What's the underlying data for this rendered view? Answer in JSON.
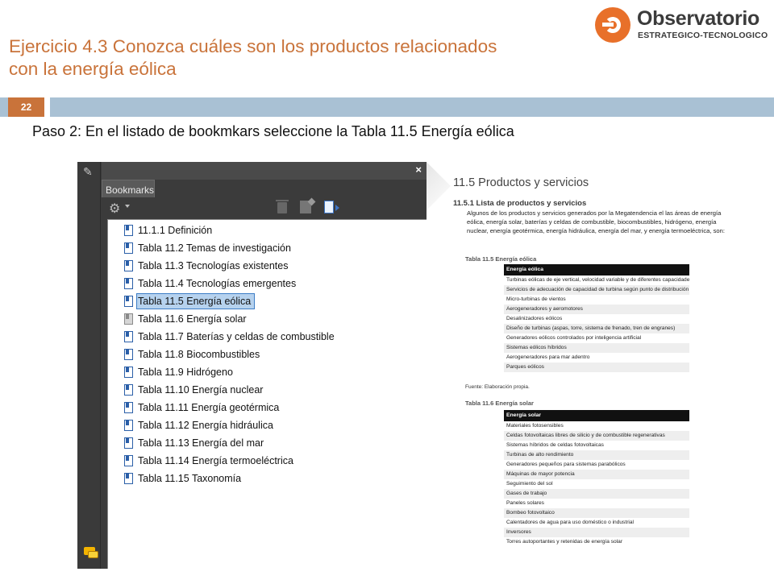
{
  "slide": {
    "title_line1": "Ejercicio 4.3 Conozca cuáles son los productos relacionados",
    "title_line2": "con la energía eólica",
    "page_number": "22",
    "step_text": "Paso 2: En el listado de bookmkars seleccione la Tabla 11.5 Energía eólica"
  },
  "logo": {
    "name": "Observatorio",
    "subtitle": "ESTRATEGICO-TECNOLOGICO"
  },
  "panel": {
    "close_label": "×",
    "tab_label": "Bookmarks",
    "gear_icon_label": "⚙",
    "bookmarks": [
      {
        "label": "11.1.1 Definición",
        "selected": false,
        "icon": "bookmark-icon"
      },
      {
        "label": "Tabla 11.2 Temas de investigación",
        "selected": false,
        "icon": "bookmark-icon"
      },
      {
        "label": "Tabla 11.3 Tecnologías existentes",
        "selected": false,
        "icon": "bookmark-icon"
      },
      {
        "label": "Tabla 11.4 Tecnologías emergentes",
        "selected": false,
        "icon": "bookmark-icon"
      },
      {
        "label": "Tabla 11.5 Energía eólica",
        "selected": true,
        "icon": "bookmark-icon"
      },
      {
        "label": "Tabla 11.6 Energía solar",
        "selected": false,
        "icon": "bookmark-gray-icon"
      },
      {
        "label": "Tabla 11.7 Baterías y celdas de combustible",
        "selected": false,
        "icon": "bookmark-icon"
      },
      {
        "label": "Tabla 11.8 Biocombustibles",
        "selected": false,
        "icon": "bookmark-icon"
      },
      {
        "label": "Tabla 11.9 Hidrógeno",
        "selected": false,
        "icon": "bookmark-icon"
      },
      {
        "label": "Tabla 11.10 Energía nuclear",
        "selected": false,
        "icon": "bookmark-icon"
      },
      {
        "label": "Tabla 11.11 Energía geotérmica",
        "selected": false,
        "icon": "bookmark-icon"
      },
      {
        "label": "Tabla 11.12 Energía hidráulica",
        "selected": false,
        "icon": "bookmark-icon"
      },
      {
        "label": "Tabla 11.13 Energía del mar",
        "selected": false,
        "icon": "bookmark-icon"
      },
      {
        "label": "Tabla 11.14 Energía termoeléctrica",
        "selected": false,
        "icon": "bookmark-icon"
      },
      {
        "label": "Tabla 11.15 Taxonomía",
        "selected": false,
        "icon": "bookmark-icon"
      }
    ]
  },
  "document": {
    "heading": "11.5 Productos y servicios",
    "subheading": "11.5.1 Lista de productos y servicios",
    "paragraph": "Algunos de los productos y servicios generados por la Megatendencia el las áreas de energía eólica, energía solar, baterías y celdas de combustible, biocombustibles, hidrógeno, energía nuclear, energía geotérmica, energía hidráulica, energía del mar, y energía termoeléctrica, son:",
    "table1": {
      "caption": "Tabla 11.5 Energía eólica",
      "header": "Energía eólica",
      "rows": [
        "Turbinas eólicas de eje vertical, velocidad variable y de diferentes capacidades",
        "Servicios de adecuación de capacidad de turbina según punto de distribución",
        "Micro-turbinas de vientos",
        "Aerogeneradores y aeromotores",
        "Desalinizadores eólicos",
        "Diseño de turbinas (aspas, torre, sistema de frenado, tren de engranes)",
        "Generadores eólicos controlados por inteligencia artificial",
        "Sistemas eólicos híbridos",
        "Aerogeneradores para mar adentro",
        "Parques eólicos"
      ],
      "source": "Fuente: Elaboración propia."
    },
    "table2": {
      "caption": "Tabla 11.6 Energía solar",
      "header": "Energía solar",
      "rows": [
        "Materiales fotosensibles",
        "Celdas fotovoltaicas libres de silicio y de combustible regenerativas",
        "Sistemas híbridos de celdas fotovoltaicas",
        "Turbinas de alto rendimiento",
        "Generadores pequeños para sistemas parabólicos",
        "Máquinas de mayor potencia",
        "Seguimiento del sol",
        "Gases de trabajo",
        "Paneles solares",
        "Bombeo fotovoltaico",
        "Calentadores de agua para uso doméstico o industrial",
        "Inversores",
        "Torres autoportantes y retenidas de energía solar"
      ]
    }
  }
}
